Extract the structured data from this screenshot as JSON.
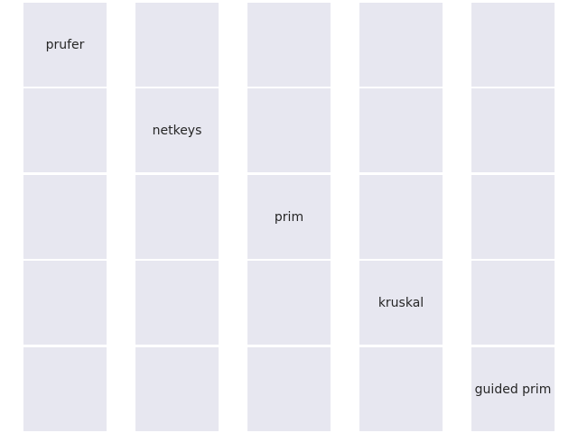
{
  "chart_data": {
    "type": "grid",
    "rows": 5,
    "cols": 5,
    "background_color": "#e7e7f0",
    "text_color": "#262626",
    "labels": [
      "prufer",
      "netkeys",
      "prim",
      "kruskal",
      "guided prim"
    ],
    "diagonal_only": true
  }
}
